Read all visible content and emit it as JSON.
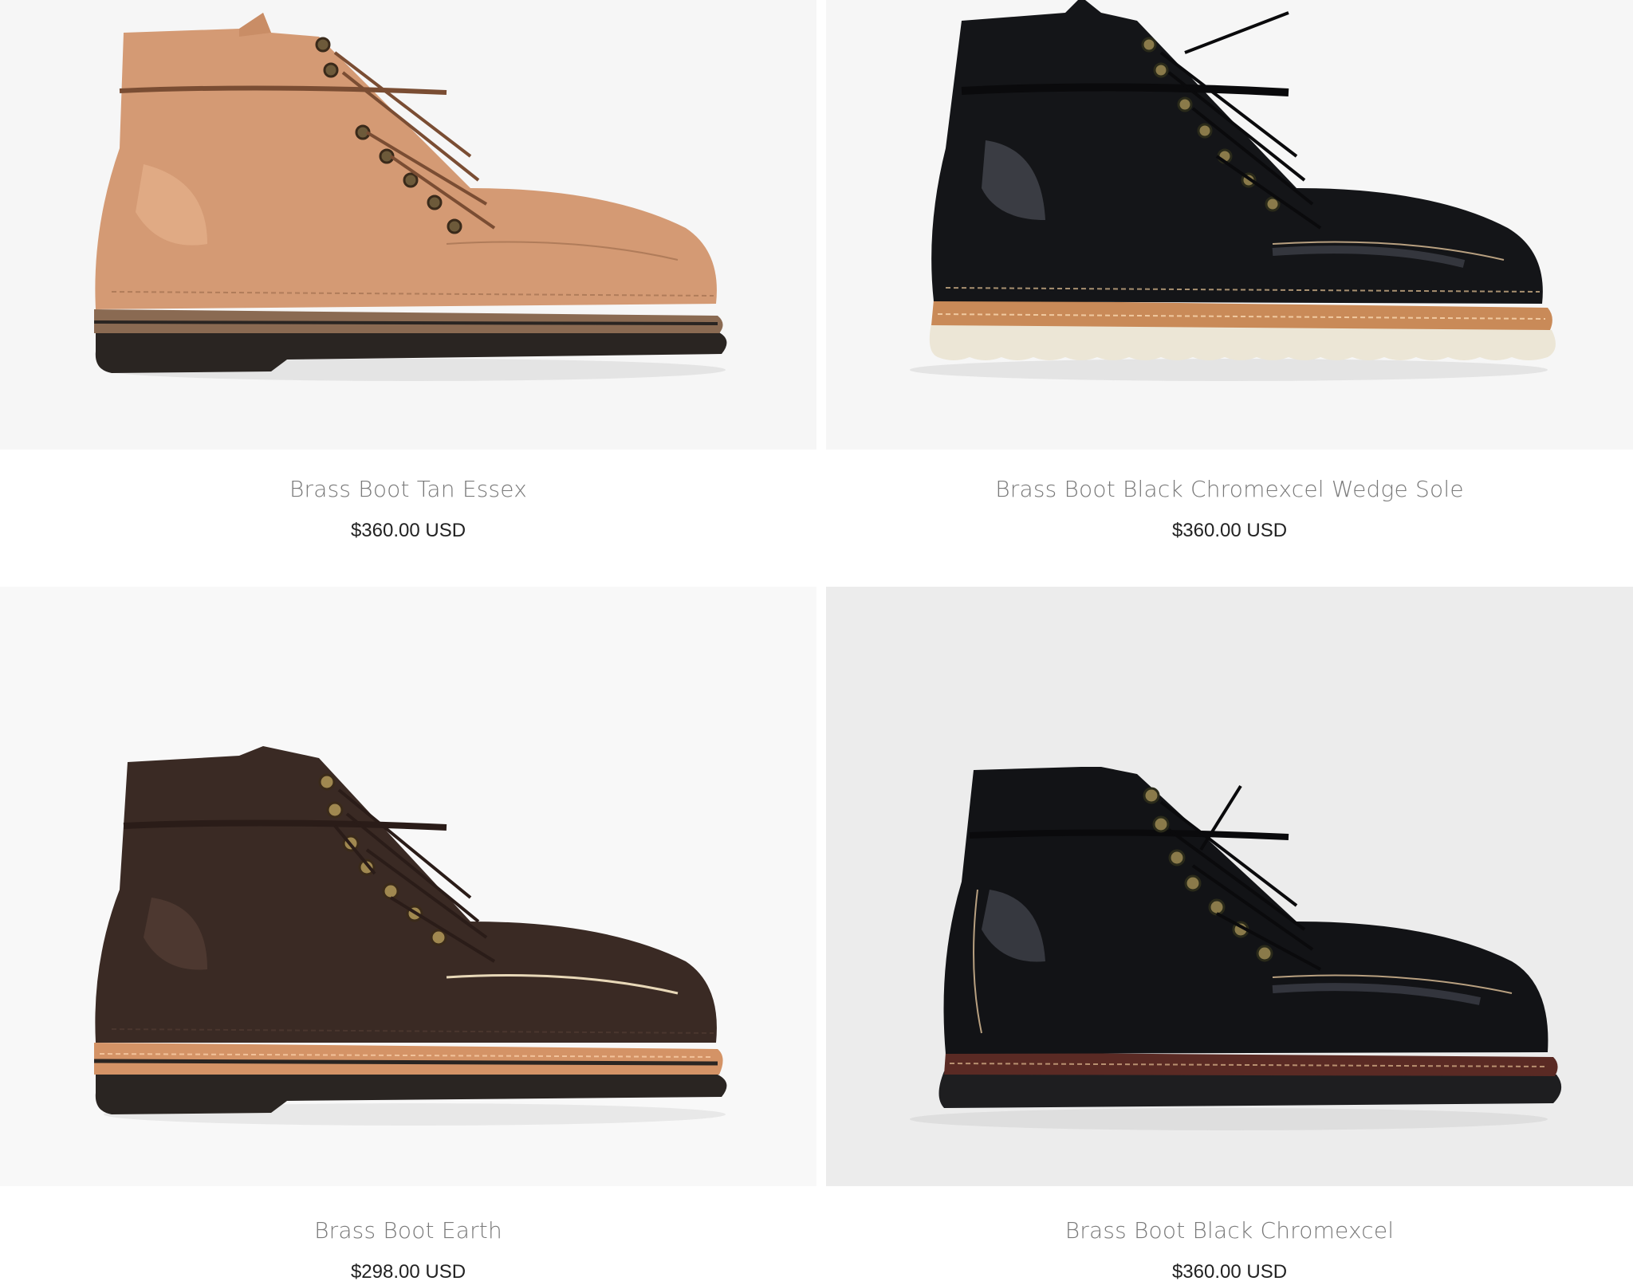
{
  "products": [
    {
      "name": "Brass Boot Tan Essex",
      "price": "$360.00 USD",
      "image_icon": "tan-boot-image",
      "upper_color": "#d49a74",
      "sole_color": "#2a2522",
      "welt_color": "#8a6a52"
    },
    {
      "name": "Brass Boot Black Chromexcel Wedge Sole",
      "price": "$360.00 USD",
      "image_icon": "black-wedge-boot-image",
      "upper_color": "#141518",
      "sole_color": "#ece6d6",
      "welt_color": "#c98a58"
    },
    {
      "name": "Brass Boot Earth",
      "price": "$298.00 USD",
      "image_icon": "earth-boot-image",
      "upper_color": "#3a2a24",
      "sole_color": "#2a2522",
      "welt_color": "#d49366"
    },
    {
      "name": "Brass Boot Black Chromexcel",
      "price": "$360.00 USD",
      "image_icon": "black-boot-image",
      "upper_color": "#121316",
      "sole_color": "#1e1e20",
      "welt_color": "#5a2a24"
    }
  ]
}
